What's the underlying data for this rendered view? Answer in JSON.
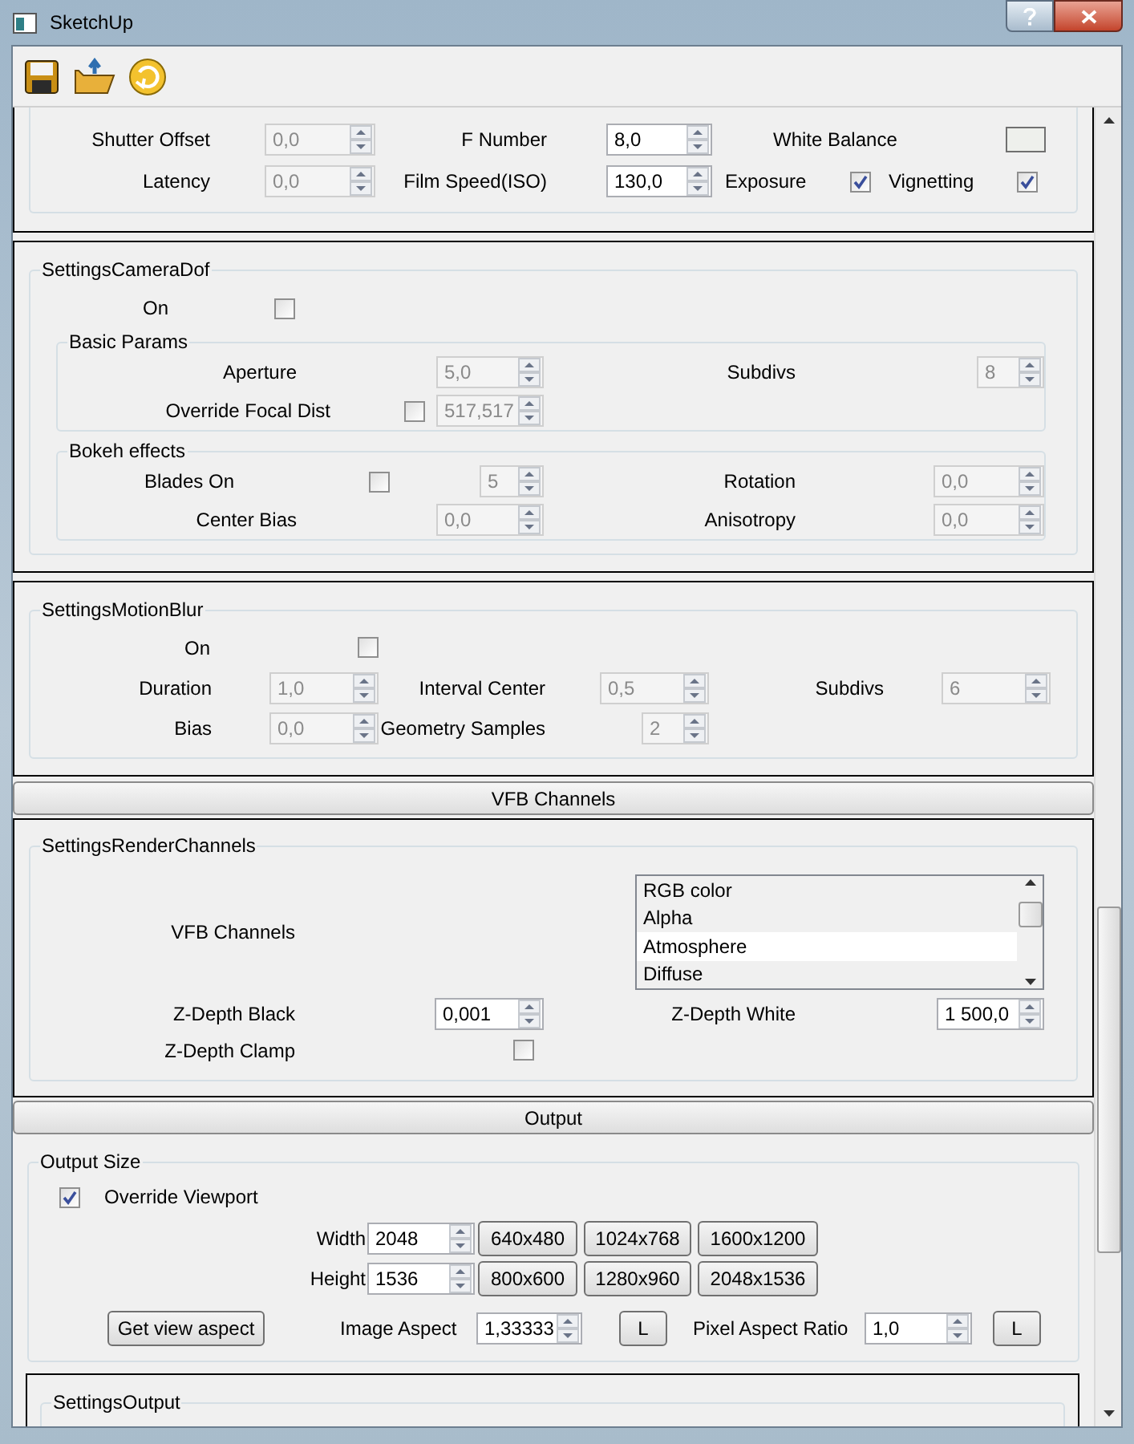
{
  "window": {
    "title": "SketchUp"
  },
  "camera": {
    "shutter_offset": {
      "label": "Shutter Offset",
      "value": "0,0",
      "disabled": true
    },
    "f_number": {
      "label": "F Number",
      "value": "8,0",
      "disabled": false
    },
    "white_balance": {
      "label": "White Balance",
      "color": "#eef0ec"
    },
    "latency": {
      "label": "Latency",
      "value": "0,0",
      "disabled": true
    },
    "film_speed": {
      "label": "Film Speed(ISO)",
      "value": "130,0",
      "disabled": false
    },
    "exposure": {
      "label": "Exposure",
      "checked": true
    },
    "vignetting": {
      "label": "Vignetting",
      "checked": true
    }
  },
  "dof": {
    "title": "SettingsCameraDof",
    "on": {
      "label": "On",
      "checked": false
    },
    "basic": {
      "title": "Basic Params",
      "aperture": {
        "label": "Aperture",
        "value": "5,0",
        "disabled": true
      },
      "subdivs": {
        "label": "Subdivs",
        "value": "8",
        "disabled": true
      },
      "override_focal_dist": {
        "label": "Override Focal Dist",
        "checked": false,
        "value": "517,517",
        "disabled": true
      }
    },
    "bokeh": {
      "title": "Bokeh effects",
      "blades_on": {
        "label": "Blades On",
        "checked": false,
        "value": "5",
        "disabled": true
      },
      "rotation": {
        "label": "Rotation",
        "value": "0,0",
        "disabled": true
      },
      "center_bias": {
        "label": "Center Bias",
        "value": "0,0",
        "disabled": true
      },
      "anisotropy": {
        "label": "Anisotropy",
        "value": "0,0",
        "disabled": true
      }
    }
  },
  "motion_blur": {
    "title": "SettingsMotionBlur",
    "on": {
      "label": "On",
      "checked": false
    },
    "duration": {
      "label": "Duration",
      "value": "1,0",
      "disabled": true
    },
    "interval_center": {
      "label": "Interval Center",
      "value": "0,5",
      "disabled": true
    },
    "subdivs": {
      "label": "Subdivs",
      "value": "6",
      "disabled": true
    },
    "bias": {
      "label": "Bias",
      "value": "0,0",
      "disabled": true
    },
    "geometry_samples": {
      "label": "Geometry Samples",
      "value": "2",
      "disabled": true
    }
  },
  "vfb_button": {
    "label": "VFB Channels"
  },
  "render_channels": {
    "title": "SettingsRenderChannels",
    "vfb_channels": {
      "label": "VFB Channels",
      "items": [
        {
          "label": "RGB color",
          "selected": false
        },
        {
          "label": "Alpha",
          "selected": false
        },
        {
          "label": "Atmosphere",
          "selected": true
        },
        {
          "label": "Diffuse",
          "selected": false
        }
      ]
    },
    "zdepth_black": {
      "label": "Z-Depth Black",
      "value": "0,001",
      "disabled": false
    },
    "zdepth_white": {
      "label": "Z-Depth White",
      "value": "1 500,0",
      "disabled": false
    },
    "zdepth_clamp": {
      "label": "Z-Depth Clamp",
      "checked": false
    }
  },
  "output_button": {
    "label": "Output"
  },
  "output_size": {
    "title": "Output Size",
    "override_viewport": {
      "label": "Override Viewport",
      "checked": true
    },
    "width": {
      "label": "Width",
      "value": "2048",
      "disabled": false,
      "presets": [
        "640x480",
        "1024x768",
        "1600x1200"
      ]
    },
    "height": {
      "label": "Height",
      "value": "1536",
      "disabled": false,
      "presets": [
        "800x600",
        "1280x960",
        "2048x1536"
      ]
    },
    "get_view_aspect": {
      "label": "Get view aspect"
    },
    "image_aspect": {
      "label": "Image Aspect",
      "value": "1,33333",
      "disabled": false,
      "lock": "L"
    },
    "pixel_aspect_ratio": {
      "label": "Pixel Aspect Ratio",
      "value": "1,0",
      "disabled": false,
      "lock": "L"
    }
  },
  "settings_output": {
    "title": "SettingsOutput"
  }
}
